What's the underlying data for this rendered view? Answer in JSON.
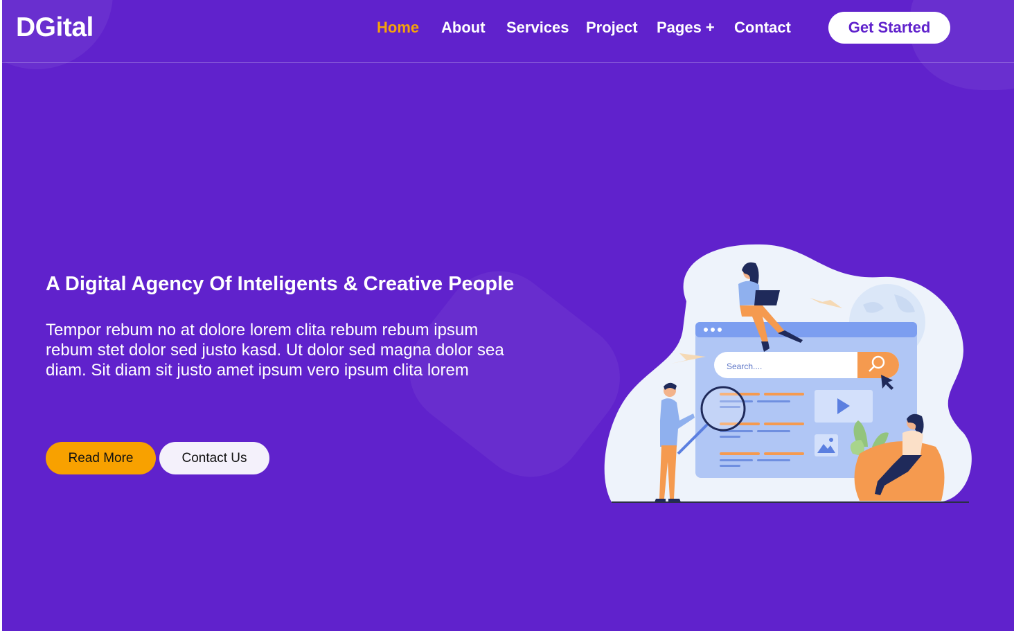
{
  "brand": {
    "name": "DGital"
  },
  "nav": {
    "items": [
      "Home",
      "About",
      "Services",
      "Project",
      "Pages +",
      "Contact"
    ],
    "active": "Home",
    "cta": "Get Started"
  },
  "hero": {
    "title": "A Digital Agency Of Inteligents & Creative People",
    "text": "Tempor rebum no at dolore lorem clita rebum rebum ipsum rebum stet dolor sed justo kasd. Ut dolor sed magna dolor sea diam. Sit diam sit justo amet ipsum vero ipsum clita lorem",
    "buttons": {
      "read_more": "Read More",
      "contact_us": "Contact Us"
    },
    "illustration": {
      "search_placeholder": "Search...."
    }
  },
  "colors": {
    "background": "#6022cc",
    "accent": "#f8a100",
    "active_nav": "#f5a20a",
    "white": "#ffffff"
  }
}
